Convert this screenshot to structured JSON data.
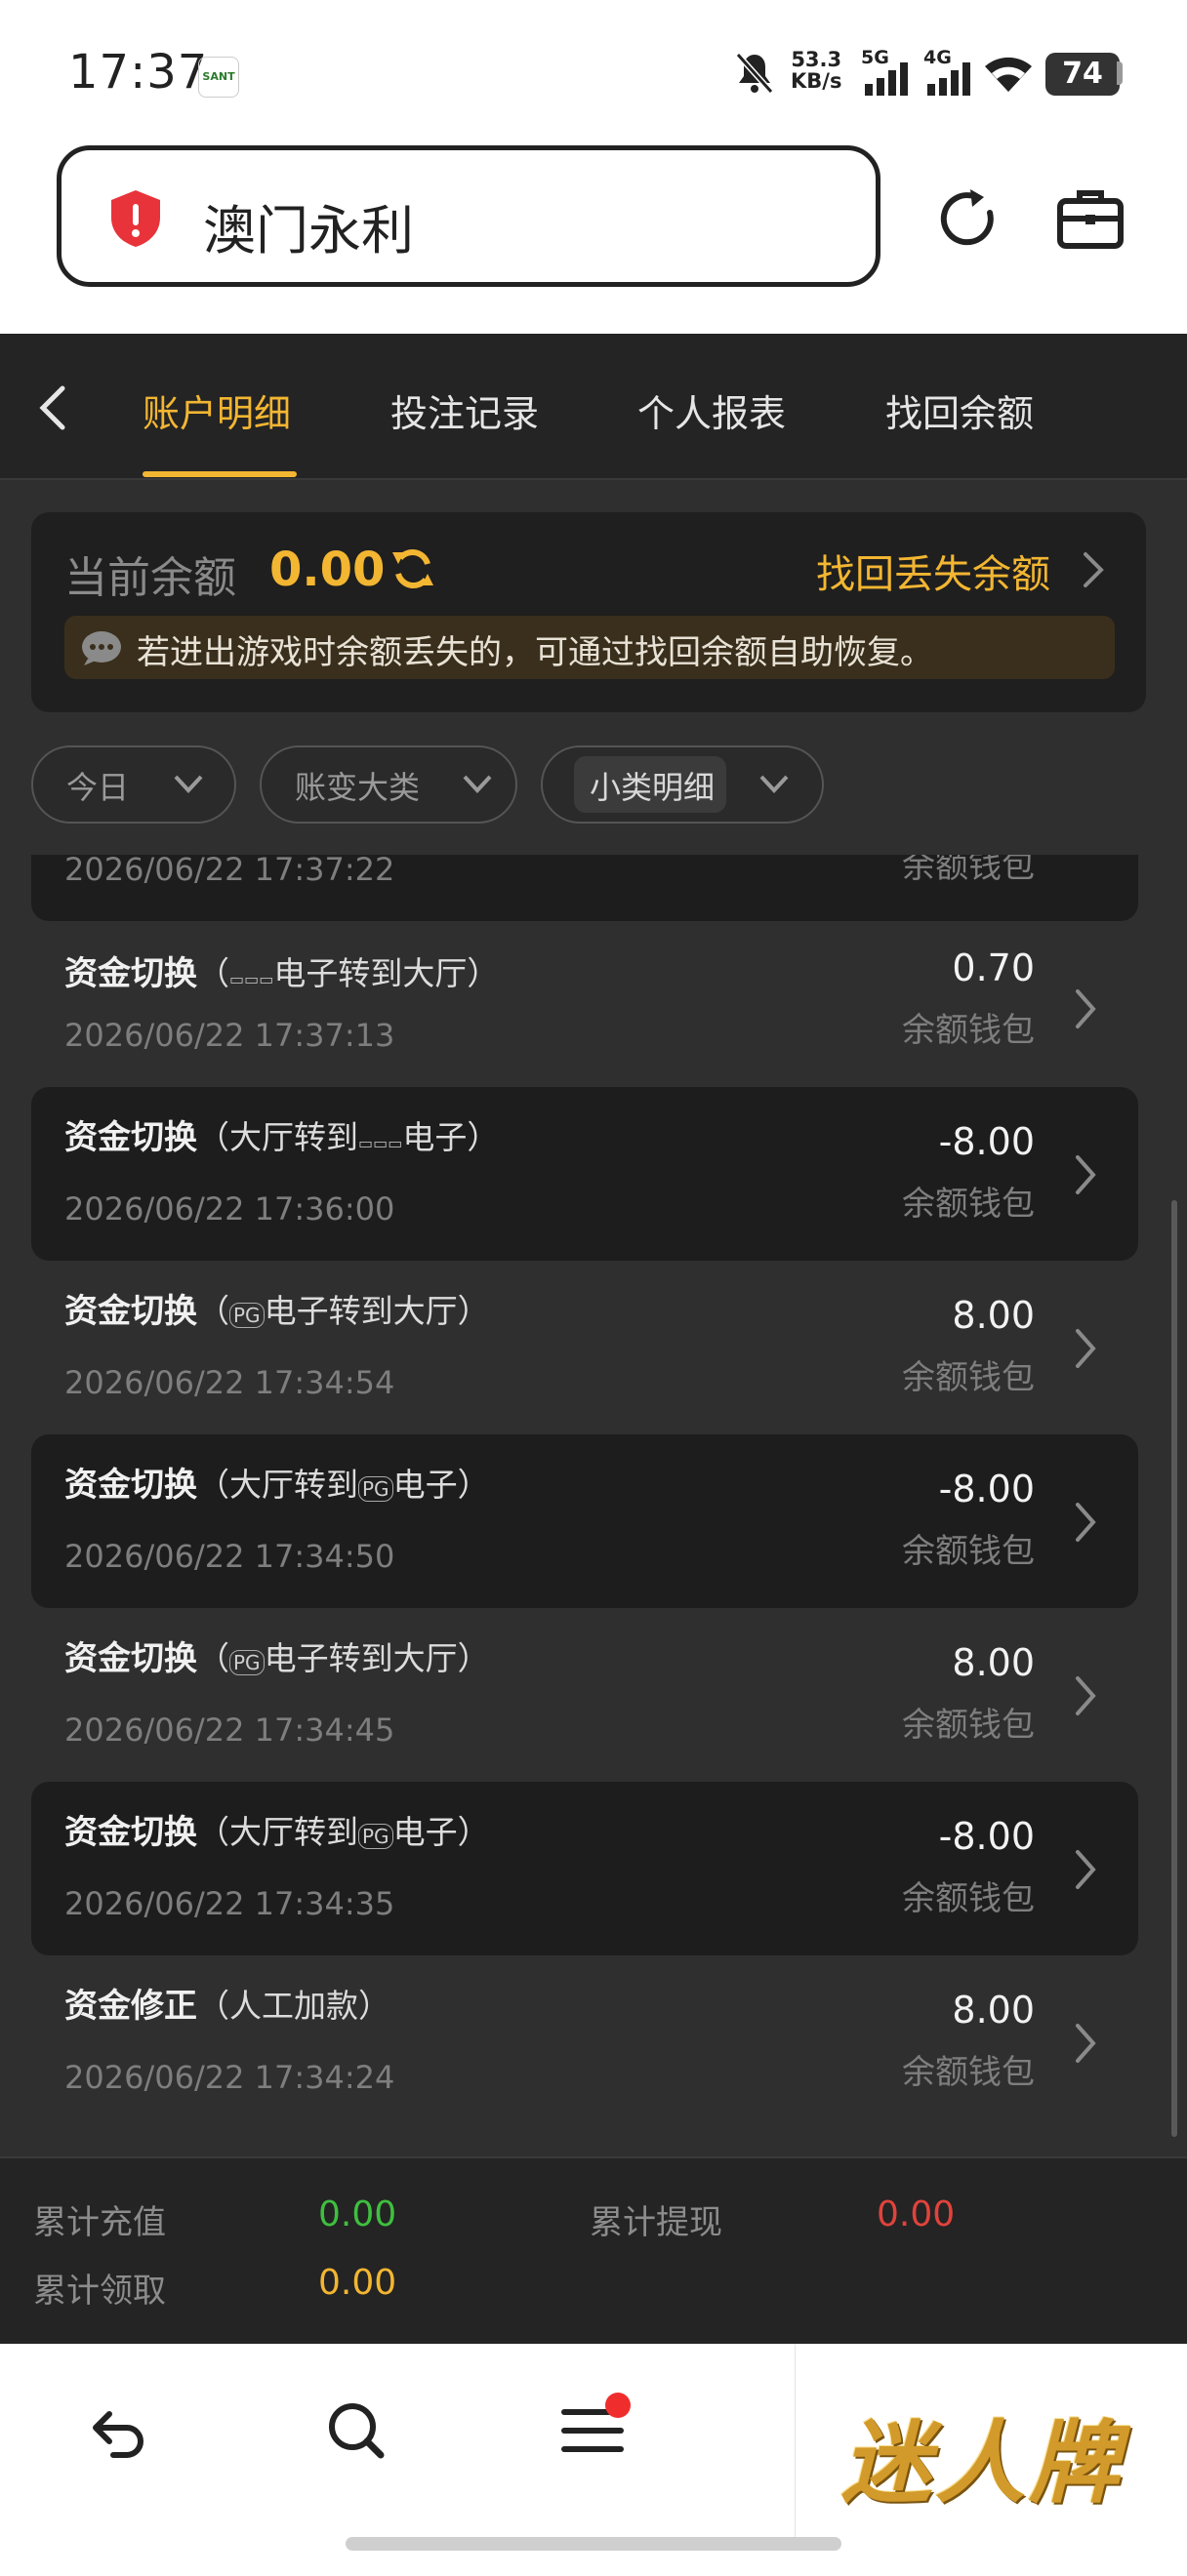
{
  "status_bar": {
    "time": "17:37",
    "app_badge": "SANT",
    "net_speed_value": "53.3",
    "net_speed_unit": "KB/s",
    "sig1": "5G",
    "sig2": "4G",
    "battery": "74"
  },
  "url_bar": {
    "title": "澳门永利",
    "security_icon": "warning-shield-icon"
  },
  "tabs": {
    "items": [
      {
        "label": "账户明细",
        "active": true
      },
      {
        "label": "投注记录",
        "active": false
      },
      {
        "label": "个人报表",
        "active": false
      },
      {
        "label": "找回余额",
        "active": false
      }
    ]
  },
  "balance": {
    "label": "当前余额",
    "value": "0.00",
    "recover_link": "找回丢失余额",
    "notice": "若进出游戏时余额丢失的，可通过找回余额自助恢复。"
  },
  "filters": [
    {
      "label": "今日"
    },
    {
      "label": "账变大类"
    },
    {
      "label": "小类明细"
    }
  ],
  "partial_row": {
    "time": "2026/06/22 17:37:22",
    "wallet": "余额钱包"
  },
  "records": [
    {
      "title": "资金切换",
      "pre": "（",
      "logo": "▭▭▭",
      "detail": "电子转到大厅）",
      "time": "2026/06/22 17:37:13",
      "amount": "0.70",
      "wallet": "余额钱包",
      "dark": false
    },
    {
      "title": "资金切换",
      "pre": "（大厅转到",
      "logo": "▭▭▭",
      "detail": "电子）",
      "time": "2026/06/22 17:36:00",
      "amount": "-8.00",
      "wallet": "余额钱包",
      "dark": true
    },
    {
      "title": "资金切换",
      "pre": "（",
      "logo": "PG",
      "detail": "电子转到大厅）",
      "time": "2026/06/22 17:34:54",
      "amount": "8.00",
      "wallet": "余额钱包",
      "dark": false
    },
    {
      "title": "资金切换",
      "pre": "（大厅转到",
      "logo": "PG",
      "detail": "电子）",
      "time": "2026/06/22 17:34:50",
      "amount": "-8.00",
      "wallet": "余额钱包",
      "dark": true
    },
    {
      "title": "资金切换",
      "pre": "（",
      "logo": "PG",
      "detail": "电子转到大厅）",
      "time": "2026/06/22 17:34:45",
      "amount": "8.00",
      "wallet": "余额钱包",
      "dark": false
    },
    {
      "title": "资金切换",
      "pre": "（大厅转到",
      "logo": "PG",
      "detail": "电子）",
      "time": "2026/06/22 17:34:35",
      "amount": "-8.00",
      "wallet": "余额钱包",
      "dark": true
    },
    {
      "title": "资金修正",
      "pre": "（人工加款）",
      "logo": "",
      "detail": "",
      "time": "2026/06/22 17:34:24",
      "amount": "8.00",
      "wallet": "余额钱包",
      "dark": false
    }
  ],
  "totals": {
    "recharge_label": "累计充值",
    "recharge_value": "0.00",
    "recharge_color": "#3fbf3f",
    "withdraw_label": "累计提现",
    "withdraw_value": "0.00",
    "withdraw_color": "#e0433c",
    "claim_label": "累计领取",
    "claim_value": "0.00",
    "claim_color": "#f3b632"
  },
  "bottom_nav": {
    "items": [
      "back-arrow-icon",
      "search-icon",
      "menu-icon"
    ],
    "ad_text": "迷人牌"
  },
  "colors": {
    "accent": "#f3b632",
    "panel": "#1d1d1d",
    "background": "#2f2f2f"
  }
}
